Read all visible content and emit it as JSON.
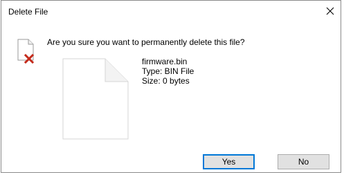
{
  "window": {
    "title": "Delete File",
    "close_icon": "close-icon"
  },
  "message": {
    "question": "Are you sure you want to permanently delete this file?",
    "icon": "delete-file-icon"
  },
  "file": {
    "icon": "file-icon",
    "name": "firmware.bin",
    "type": "Type: BIN File",
    "size": "Size: 0 bytes"
  },
  "buttons": {
    "yes_label": "Yes",
    "no_label": "No"
  },
  "colors": {
    "accent": "#0078d7",
    "delete_x": "#c42b1c",
    "button_bg": "#e1e1e1"
  }
}
